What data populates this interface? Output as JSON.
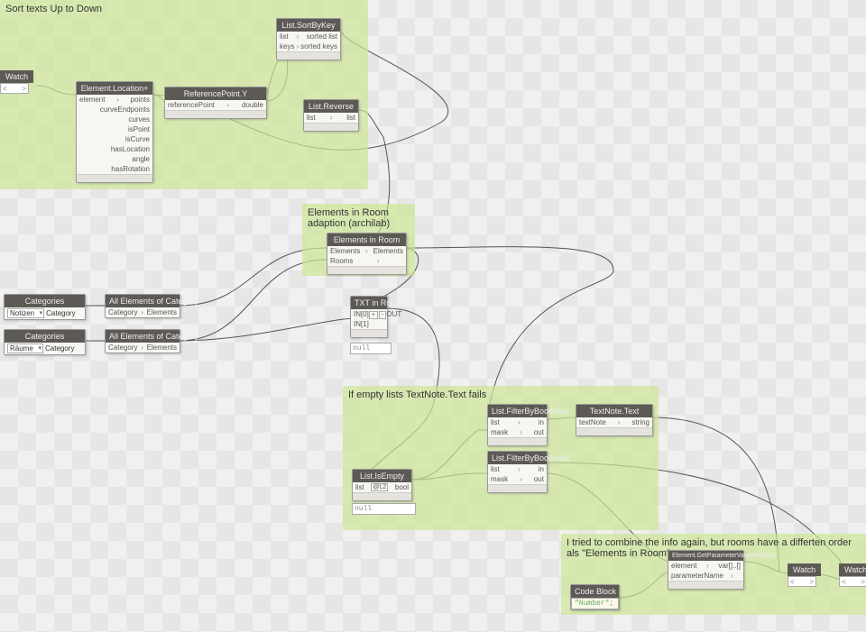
{
  "groups": {
    "g1": {
      "title": "Sort texts Up to Down"
    },
    "g2": {
      "title": "Elements in Room\nadaption (archilab)"
    },
    "g3": {
      "title": "If empty lists TextNote.Text fails"
    },
    "g4": {
      "title": "I tried to combine the info again, but rooms have a\ndifferten order als \"Elements in Room\" output"
    }
  },
  "nodes": {
    "sortByKey": {
      "title": "List.SortByKey",
      "in": [
        "list",
        "keys"
      ],
      "out": [
        "sorted list",
        "sorted keys"
      ]
    },
    "watch1": {
      "title": "Watch"
    },
    "elemLoc": {
      "title": "Element.Location+",
      "in": [
        "element"
      ],
      "out": [
        "points",
        "curveEndpoints",
        "curves",
        "isPoint",
        "isCurve",
        "hasLocation",
        "angle",
        "hasRotation"
      ]
    },
    "refY": {
      "title": "ReferencePoint.Y",
      "in": [
        "referencePoint"
      ],
      "out": [
        "double"
      ]
    },
    "listRev": {
      "title": "List.Reverse",
      "in": [
        "list"
      ],
      "out": [
        "list"
      ]
    },
    "elemInRoom": {
      "title": "Elements in Room",
      "in": [
        "Elements",
        "Rooms"
      ],
      "out": [
        "Elements"
      ]
    },
    "cat1": {
      "title": "Categories",
      "sel": "Notizen",
      "out": "Category"
    },
    "allCat1": {
      "title": "All Elements of Category",
      "in": [
        "Category"
      ],
      "out": [
        "Elements"
      ]
    },
    "cat2": {
      "title": "Categories",
      "sel": "Räume",
      "out": "Category"
    },
    "allCat2": {
      "title": "All Elements of Category",
      "in": [
        "Category"
      ],
      "out": [
        "Elements"
      ]
    },
    "txtRoom": {
      "title": "TXT in Room",
      "in": [
        "IN[0]",
        "IN[1]"
      ],
      "out": [
        "OUT"
      ],
      "plus": "+",
      "minus": "-"
    },
    "txtNull": "null",
    "filter1": {
      "title": "List.FilterByBoolMask",
      "in": [
        "list",
        "mask"
      ],
      "out": [
        "in",
        "out"
      ]
    },
    "filter2": {
      "title": "List.FilterByBoolMask",
      "in": [
        "list",
        "mask"
      ],
      "out": [
        "in",
        "out"
      ]
    },
    "isEmpty": {
      "title": "List.IsEmpty",
      "in": [
        "list"
      ],
      "lacing": "@L2",
      "out": [
        "bool"
      ]
    },
    "isEmptyNull": "null",
    "textNote": {
      "title": "TextNote.Text",
      "in": [
        "textNote"
      ],
      "out": [
        "string"
      ]
    },
    "getParam": {
      "title": "Element.GetParameterValueByName",
      "in": [
        "element",
        "parameterName"
      ],
      "out": [
        "var[]..[]"
      ]
    },
    "codeBlock": {
      "title": "Code Block",
      "code": "\"Number\";"
    },
    "watch2": {
      "title": "Watch"
    },
    "watch3": {
      "title": "Watch"
    }
  }
}
